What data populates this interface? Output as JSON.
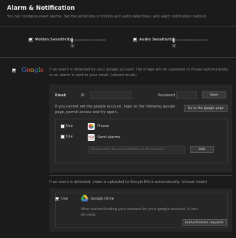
{
  "header": {
    "title": "Alarm & Notification",
    "subtitle": "You can configure event alarms. Set the sensitivity of motion and audio detections, and alarm notification method."
  },
  "sensitivity": {
    "motion_label": "Motion Sensitivity",
    "motion_value": "1",
    "audio_label": "Audio Sensitivity",
    "audio_value": "1",
    "motion_checked": true,
    "audio_checked": true
  },
  "google": {
    "logo_text": "Google",
    "enabled": true,
    "description": "If an event is detected by your google account, the image will be uploaded to Picasa automatically or an alarm is sent to your email. (closed mode)",
    "email_label": "Email",
    "id_label": "ID",
    "id_value": "",
    "password_label": "Password",
    "password_value": "",
    "save_label": "Save",
    "cannot_set_text": "If you cannot set the google account, login to the following google page, permit access and try again.",
    "go_to_google_label": "Go to the google page",
    "picasa": {
      "use_label": "Use",
      "service_label": "Picasa",
      "checked": false
    },
    "send_alarms": {
      "use_label": "Use",
      "service_label": "Send alarms",
      "checked": false,
      "recipient_placeholder": "Please enter the email address of the recipient",
      "add_label": "Add"
    }
  },
  "drive": {
    "description": "If an event is detected, video is uploaded to Google Drive automatically. (closed mode)",
    "use_label": "Use",
    "checked": true,
    "service_label": "Google Drive",
    "auth_text": "After authenticating your camera for your google account, it can be used.",
    "auth_button_label": "Authentication requests."
  },
  "colors": {
    "background": "#1b1b1b",
    "panel": "#262626",
    "google_blue": "#4a79d6",
    "google_red": "#d64a3a",
    "google_yellow": "#e8b431",
    "google_green": "#3aa35a"
  }
}
